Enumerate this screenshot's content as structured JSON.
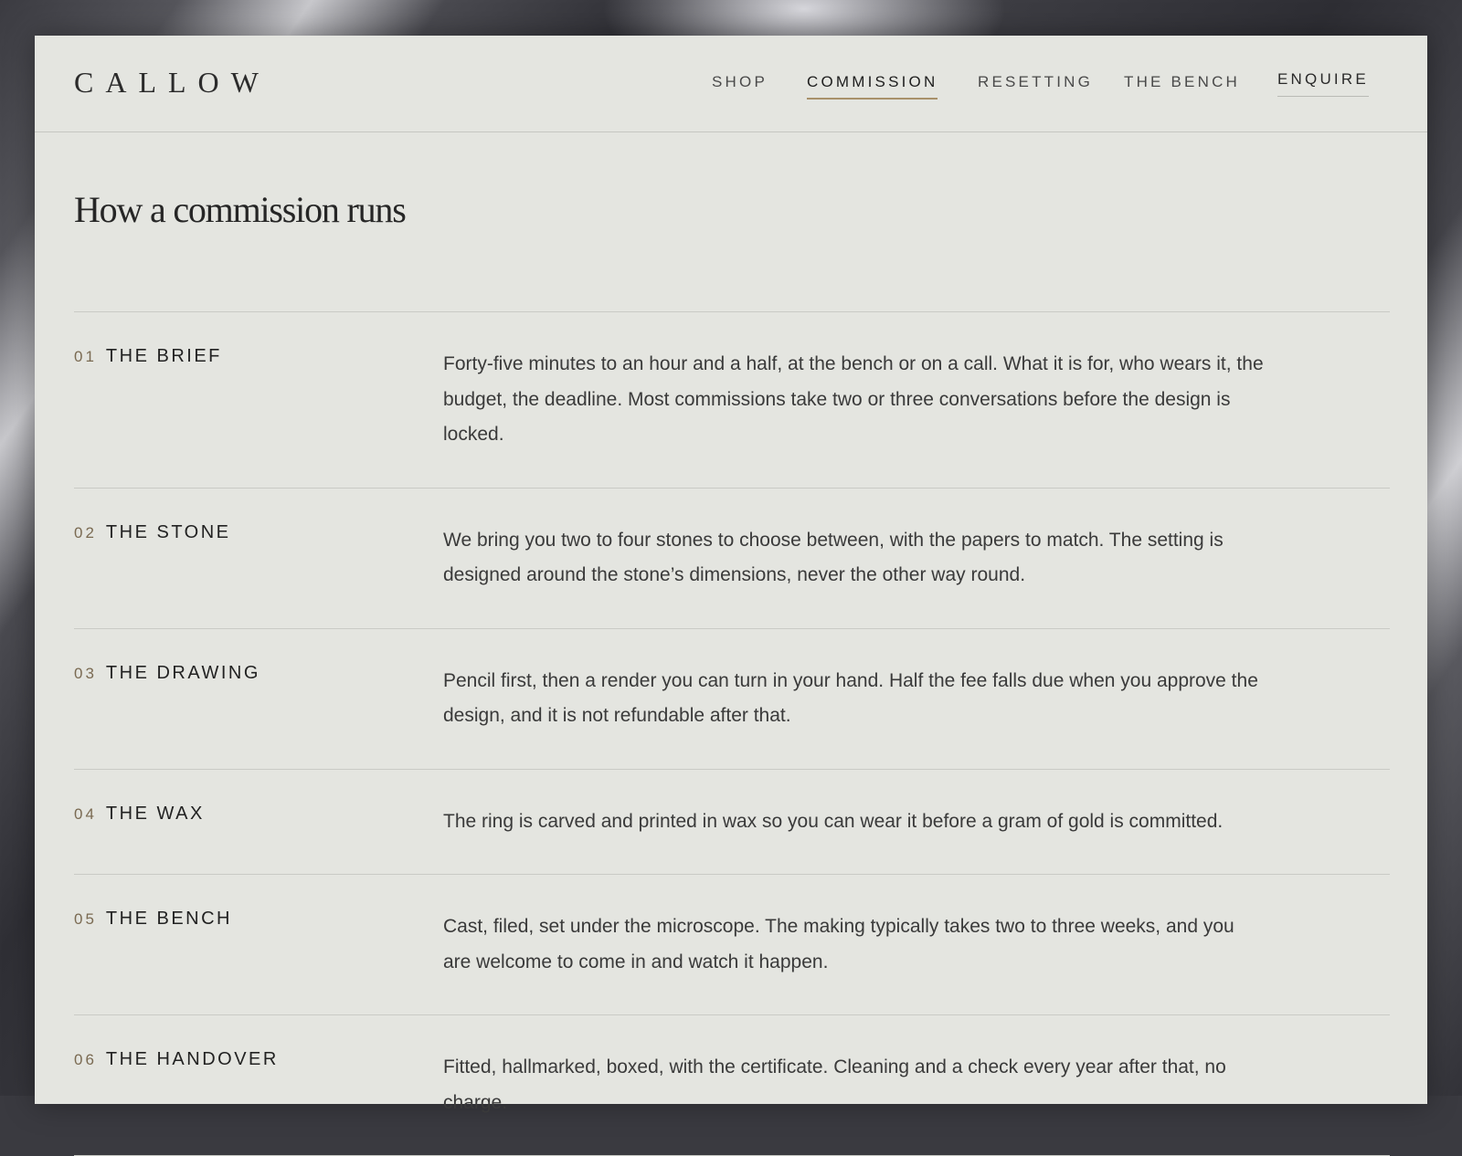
{
  "brand": {
    "logo": "CALLOW"
  },
  "nav": {
    "items": [
      {
        "label": "SHOP",
        "active": false
      },
      {
        "label": "COMMISSION",
        "active": true
      },
      {
        "label": "RESETTING",
        "active": false
      },
      {
        "label": "THE BENCH",
        "active": false
      }
    ],
    "cta": "ENQUIRE"
  },
  "page": {
    "title": "How a commission runs"
  },
  "steps": [
    {
      "number": "01",
      "name": "THE BRIEF",
      "description": "Forty-five minutes to an hour and a half, at the bench or on a call. What it is for, who wears it, the budget, the deadline. Most commissions take two or three conversations before the design is locked."
    },
    {
      "number": "02",
      "name": "THE STONE",
      "description": "We bring you two to four stones to choose between, with the papers to match. The setting is designed around the stone’s dimensions, never the other way round."
    },
    {
      "number": "03",
      "name": "THE DRAWING",
      "description": "Pencil first, then a render you can turn in your hand. Half the fee falls due when you approve the design, and it is not refundable after that."
    },
    {
      "number": "04",
      "name": "THE WAX",
      "description": "The ring is carved and printed in wax so you can wear it before a gram of gold is committed."
    },
    {
      "number": "05",
      "name": "THE BENCH",
      "description": "Cast, filed, set under the microscope. The making typically takes two to three weeks, and you are welcome to come in and watch it happen."
    },
    {
      "number": "06",
      "name": "THE HANDOVER",
      "description": "Fitted, hallmarked, boxed, with the certificate. Cleaning and a check every year after that, no charge."
    }
  ],
  "colors": {
    "background": "#e4e5e0",
    "accent": "#a8916a",
    "text": "#262626"
  }
}
